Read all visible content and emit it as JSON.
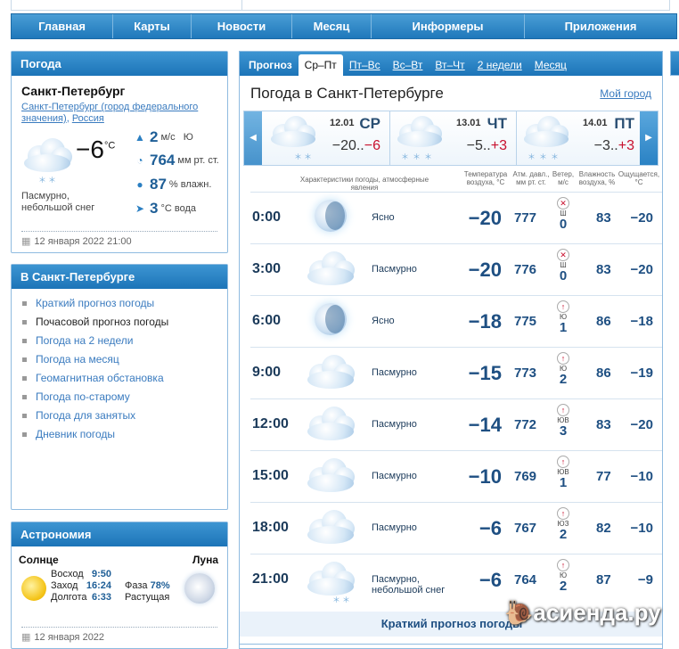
{
  "nav": [
    "Главная",
    "Карты",
    "Новости",
    "Месяц",
    "Информеры",
    "Приложения"
  ],
  "current": {
    "header": "Погода",
    "city": "Санкт-Петербург",
    "region_link": "Санкт-Петербург (город федерального значения)",
    "country_link": "Россия",
    "temp": "−6",
    "temp_unit": "°C",
    "condition": "Пасмурно, небольшой снег",
    "wind_value": "2",
    "wind_unit": "м/с",
    "wind_dir": "Ю",
    "pressure_value": "764",
    "pressure_unit": "мм рт. ст.",
    "humidity_value": "87",
    "humidity_unit": "% влажн.",
    "water_value": "3",
    "water_unit": "°C вода",
    "updated": "12 января 2022 21:00"
  },
  "city_links": {
    "header": "В Санкт-Петербурге",
    "items": [
      "Краткий прогноз погоды",
      "Почасовой прогноз погоды",
      "Погода на 2 недели",
      "Погода на месяц",
      "Геомагнитная обстановка",
      "Погода по-старому",
      "Погода для занятых",
      "Дневник погоды"
    ]
  },
  "astronomy": {
    "header": "Астрономия",
    "sun_label": "Солнце",
    "moon_label": "Луна",
    "sunrise_label": "Восход",
    "sunrise": "9:50",
    "sunset_label": "Заход",
    "sunset": "16:24",
    "daylength_label": "Долгота",
    "daylength": "6:33",
    "phase_label": "Фаза",
    "phase_value": "78%",
    "phase_state": "Растущая",
    "date": "12 января 2022"
  },
  "main": {
    "tabs": [
      "Прогноз",
      "Ср–Пт",
      "Пт–Вс",
      "Вс–Вт",
      "Вт–Чт",
      "2 недели",
      "Месяц"
    ],
    "title": "Погода в Санкт-Петербурге",
    "my_city": "Мой город",
    "days": [
      {
        "date": "12.01",
        "name": "СР",
        "low": "−20..",
        "high": "−6"
      },
      {
        "date": "13.01",
        "name": "ЧТ",
        "low": "−5..",
        "high": "+3"
      },
      {
        "date": "14.01",
        "name": "ПТ",
        "low": "−3..",
        "high": "+3"
      }
    ],
    "col_heads": {
      "cond": "Характеристики погоды, атмосферные явления",
      "temp": "Температура воздуха, °C",
      "press": "Атм. давл., мм рт. ст.",
      "wind": "Ветер, м/с",
      "hum": "Влажность воздуха, %",
      "feel": "Ощущается, °C"
    },
    "rows": [
      {
        "time": "0:00",
        "icon": "clear-night-icon",
        "desc": "Ясно",
        "temp": "−20",
        "press": "777",
        "wdir": "Ш",
        "wind": "0",
        "hum": "83",
        "feel": "−20"
      },
      {
        "time": "3:00",
        "icon": "cloudy-icon",
        "desc": "Пасмурно",
        "temp": "−20",
        "press": "776",
        "wdir": "Ш",
        "wind": "0",
        "hum": "83",
        "feel": "−20"
      },
      {
        "time": "6:00",
        "icon": "clear-night-icon",
        "desc": "Ясно",
        "temp": "−18",
        "press": "775",
        "wdir": "Ю",
        "wind": "1",
        "hum": "86",
        "feel": "−18"
      },
      {
        "time": "9:00",
        "icon": "cloudy-icon",
        "desc": "Пасмурно",
        "temp": "−15",
        "press": "773",
        "wdir": "Ю",
        "wind": "2",
        "hum": "86",
        "feel": "−19"
      },
      {
        "time": "12:00",
        "icon": "cloudy-icon",
        "desc": "Пасмурно",
        "temp": "−14",
        "press": "772",
        "wdir": "ЮВ",
        "wind": "3",
        "hum": "83",
        "feel": "−20"
      },
      {
        "time": "15:00",
        "icon": "cloudy-icon",
        "desc": "Пасмурно",
        "temp": "−10",
        "press": "769",
        "wdir": "ЮВ",
        "wind": "1",
        "hum": "77",
        "feel": "−10"
      },
      {
        "time": "18:00",
        "icon": "cloudy-icon",
        "desc": "Пасмурно",
        "temp": "−6",
        "press": "767",
        "wdir": "ЮЗ",
        "wind": "2",
        "hum": "82",
        "feel": "−10"
      },
      {
        "time": "21:00",
        "icon": "cloudy-snow-icon",
        "desc": "Пасмурно, небольшой снег",
        "temp": "−6",
        "press": "764",
        "wdir": "Ю",
        "wind": "2",
        "hum": "87",
        "feel": "−9"
      }
    ],
    "footer_link": "Краткий прогноз погоды"
  },
  "watermark": "асиенда.ру"
}
